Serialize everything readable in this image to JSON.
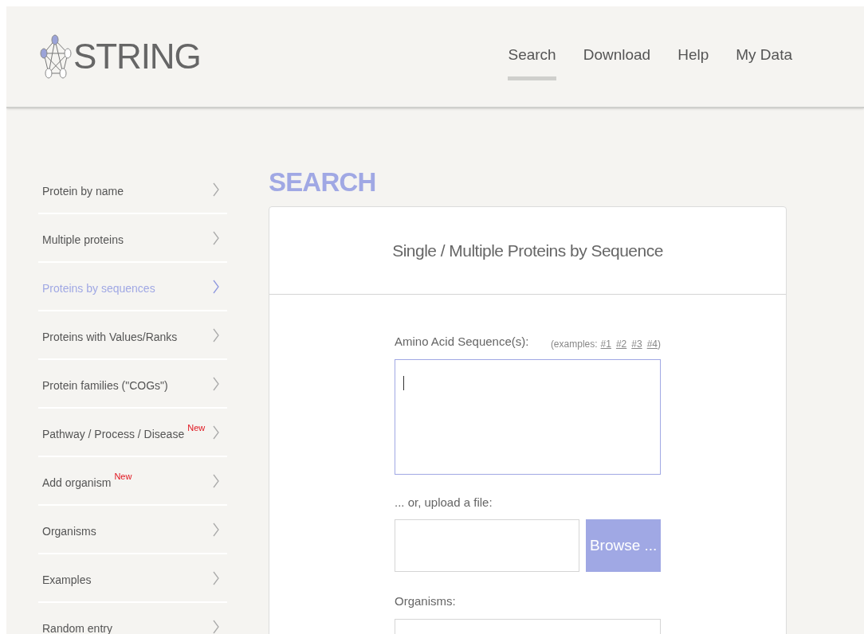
{
  "header": {
    "logo": "STRING",
    "nav": [
      {
        "label": "Search",
        "selected": true
      },
      {
        "label": "Download",
        "selected": false
      },
      {
        "label": "Help",
        "selected": false
      },
      {
        "label": "My Data",
        "selected": false
      }
    ]
  },
  "sidebar": {
    "items": [
      {
        "label": "Protein by name",
        "selected": false
      },
      {
        "label": "Multiple proteins",
        "selected": false
      },
      {
        "label": "Proteins by sequences",
        "selected": true
      },
      {
        "label": "Proteins with Values/Ranks",
        "selected": false
      },
      {
        "label": "Protein families (\"COGs\")",
        "selected": false
      },
      {
        "label": "Pathway / Process / Disease",
        "selected": false,
        "badge": "New"
      },
      {
        "label": "Add organism",
        "selected": false,
        "badge": "New"
      },
      {
        "label": "Organisms",
        "selected": false
      },
      {
        "label": "Examples",
        "selected": false
      },
      {
        "label": "Random entry",
        "selected": false
      }
    ]
  },
  "main": {
    "title": "SEARCH",
    "card": {
      "title": "Single / Multiple Proteins by Sequence",
      "sequence_label": "Amino Acid Sequence(s):",
      "examples_label": "(examples:",
      "examples": [
        "#1",
        "#2",
        "#3",
        "#4"
      ],
      "examples_close": ")",
      "sequence_field": {
        "focused": true
      },
      "upload_label": "... or, upload a file:",
      "browse_button": "Browse ...",
      "organisms_label": "Organisms:"
    }
  }
}
